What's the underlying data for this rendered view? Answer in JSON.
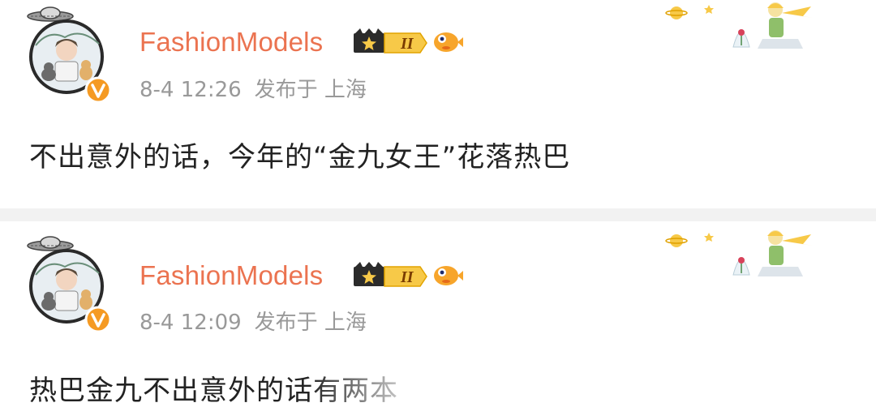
{
  "colors": {
    "username": "#eb7350",
    "meta": "#999999",
    "content": "#222222",
    "verified": "#f59a23",
    "crown": "#2b2b2b",
    "level_badge": "#f7c948",
    "separator": "#f2f2f2"
  },
  "posts": [
    {
      "username": "FashionModels",
      "level": "II",
      "time": "8-4 12:26",
      "location": "发布于 上海",
      "content": "不出意外的话，今年的“金九女王”花落热巴",
      "icons": [
        "ufo-icon",
        "avatar-image",
        "verified-v-icon",
        "crown-icon",
        "level-badge",
        "pufferfish-icon",
        "little-prince-decoration"
      ]
    },
    {
      "username": "FashionModels",
      "level": "II",
      "time": "8-4 12:09",
      "location": "发布于 上海",
      "content": "热巴金九不出意外的话有两本",
      "icons": [
        "ufo-icon",
        "avatar-image",
        "verified-v-icon",
        "crown-icon",
        "level-badge",
        "pufferfish-icon",
        "little-prince-decoration"
      ]
    }
  ]
}
